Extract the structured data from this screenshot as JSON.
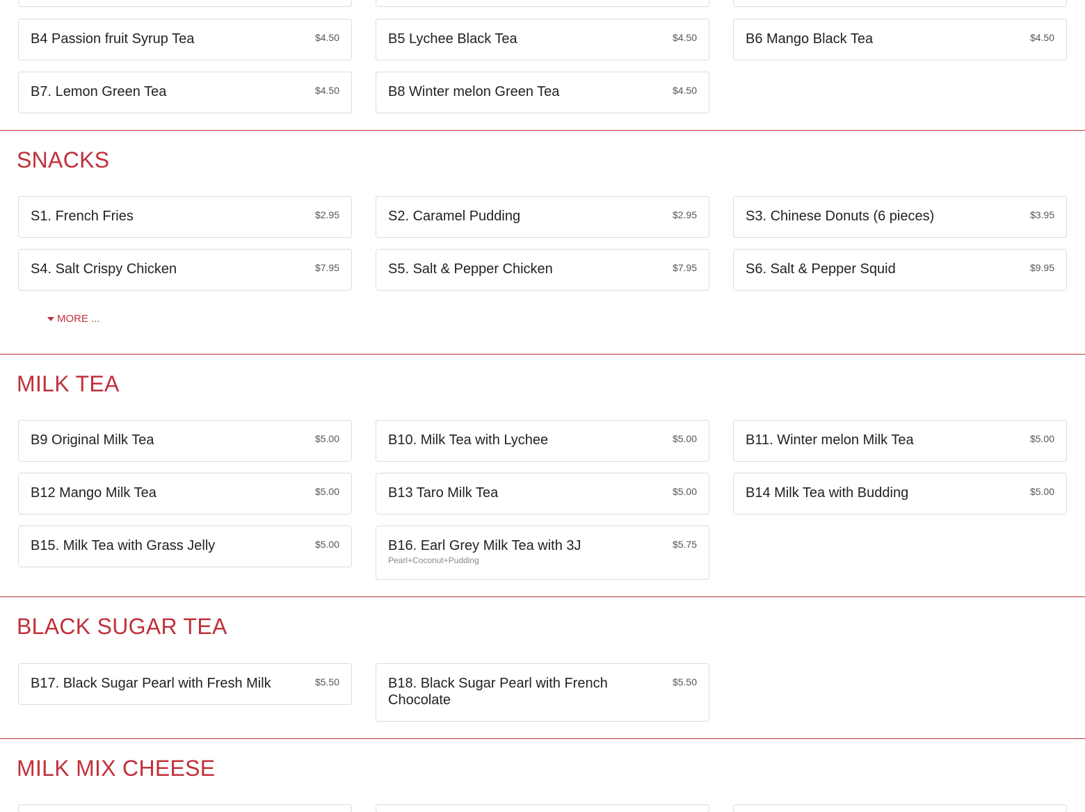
{
  "sections": {
    "bubble_tea": {
      "items": [
        {
          "name": "B4 Passion fruit Syrup Tea",
          "price": "$4.50"
        },
        {
          "name": "B5 Lychee Black Tea",
          "price": "$4.50"
        },
        {
          "name": "B6 Mango Black Tea",
          "price": "$4.50"
        },
        {
          "name": "B7. Lemon Green Tea",
          "price": "$4.50"
        },
        {
          "name": "B8 Winter melon Green Tea",
          "price": "$4.50"
        }
      ]
    },
    "snacks": {
      "title": "SNACKS",
      "items": [
        {
          "name": "S1. French Fries",
          "price": "$2.95"
        },
        {
          "name": "S2. Caramel Pudding",
          "price": "$2.95"
        },
        {
          "name": "S3. Chinese Donuts (6 pieces)",
          "price": "$3.95"
        },
        {
          "name": "S4. Salt Crispy Chicken",
          "price": "$7.95"
        },
        {
          "name": "S5. Salt & Pepper Chicken",
          "price": "$7.95"
        },
        {
          "name": "S6. Salt & Pepper Squid",
          "price": "$9.95"
        }
      ],
      "more_label": "MORE ..."
    },
    "milk_tea": {
      "title": "MILK TEA",
      "items": [
        {
          "name": "B9 Original Milk Tea",
          "price": "$5.00"
        },
        {
          "name": "B10. Milk Tea with Lychee",
          "price": "$5.00"
        },
        {
          "name": "B11. Winter melon Milk Tea",
          "price": "$5.00"
        },
        {
          "name": "B12 Mango Milk Tea",
          "price": "$5.00"
        },
        {
          "name": "B13 Taro Milk Tea",
          "price": "$5.00"
        },
        {
          "name": "B14 Milk Tea with Budding",
          "price": "$5.00"
        },
        {
          "name": "B15. Milk Tea with Grass Jelly",
          "price": "$5.00"
        },
        {
          "name": "B16. Earl Grey Milk Tea with 3J",
          "price": "$5.75",
          "description": "Pearl+Coconut+Pudding"
        }
      ]
    },
    "black_sugar_tea": {
      "title": "BLACK SUGAR TEA",
      "items": [
        {
          "name": "B17. Black Sugar Pearl with Fresh Milk",
          "price": "$5.50"
        },
        {
          "name": "B18. Black Sugar Pearl with French Chocolate",
          "price": "$5.50"
        }
      ]
    },
    "milk_mix_cheese": {
      "title": "MILK MIX CHEESE"
    }
  },
  "colors": {
    "accent": "#c0303a",
    "border": "#dcdcdc",
    "text": "#222222",
    "price": "#555555"
  },
  "icons": {
    "more": "caret-down-icon"
  }
}
